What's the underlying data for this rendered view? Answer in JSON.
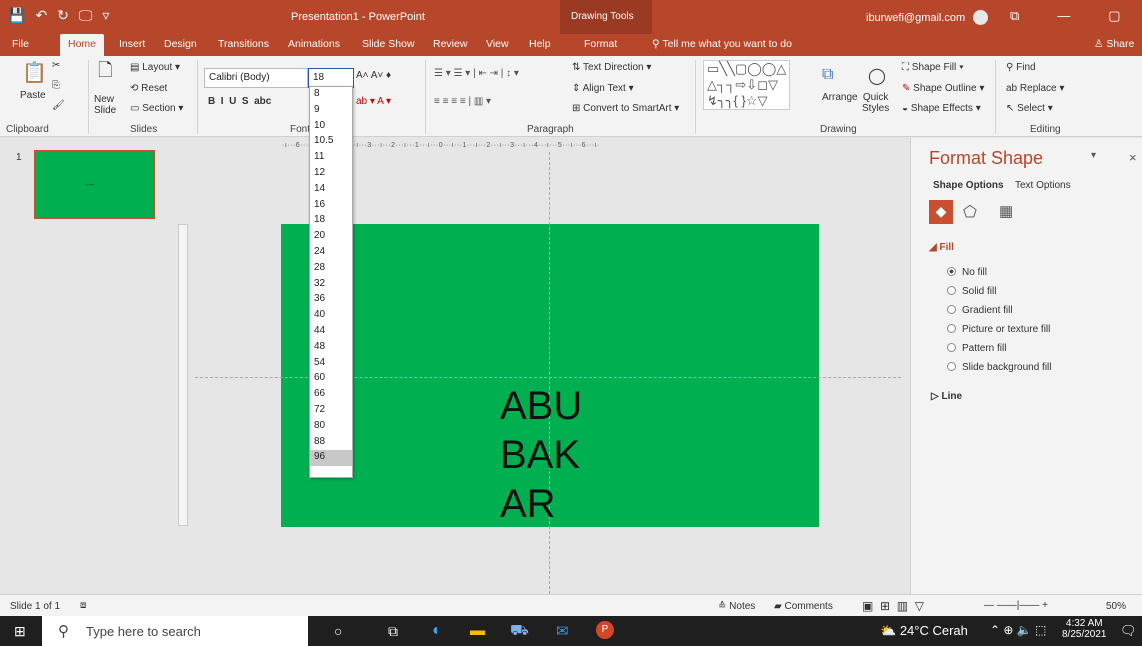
{
  "titlebar": {
    "title": "Presentation1 - PowerPoint",
    "context_tab": "Drawing Tools",
    "user": "iburwefi@gmail.com",
    "qat": [
      "💾",
      "↶",
      "↻",
      "🖵",
      "▿"
    ],
    "controls": [
      "⧉",
      "—",
      "▢"
    ]
  },
  "tabs": [
    "File",
    "Home",
    "Insert",
    "Design",
    "Transitions",
    "Animations",
    "Slide Show",
    "Review",
    "View",
    "Help",
    "Format"
  ],
  "tell_me": "Tell me what you want to do",
  "share": "Share",
  "ribbon": {
    "clipboard": {
      "paste": "Paste",
      "label": "Clipboard"
    },
    "slides": {
      "new_slide": "New\nSlide",
      "layout": "Layout",
      "reset": "Reset",
      "section": "Section",
      "label": "Slides"
    },
    "font": {
      "name": "Calibri (Body)",
      "size": "18",
      "label": "Font"
    },
    "paragraph": {
      "text_direction": "Text Direction",
      "align_text": "Align Text",
      "convert": "Convert to SmartArt",
      "label": "Paragraph"
    },
    "drawing": {
      "arrange": "Arrange",
      "quick_styles": "Quick\nStyles",
      "shape_fill": "Shape Fill",
      "shape_outline": "Shape Outline",
      "shape_effects": "Shape Effects",
      "label": "Drawing"
    },
    "editing": {
      "find": "Find",
      "replace": "Replace",
      "select": "Select",
      "label": "Editing"
    }
  },
  "font_sizes": [
    "8",
    "9",
    "10",
    "10.5",
    "11",
    "12",
    "14",
    "16",
    "18",
    "20",
    "24",
    "28",
    "32",
    "36",
    "40",
    "44",
    "48",
    "54",
    "60",
    "66",
    "72",
    "80",
    "88",
    "96"
  ],
  "selected_size": "96",
  "slide_thumb": {
    "number": "1",
    "text": "---"
  },
  "slide_text": [
    "ABU",
    "BAK",
    "AR"
  ],
  "format_pane": {
    "title": "Format Shape",
    "tab_shape": "Shape Options",
    "tab_text": "Text Options",
    "fill_heading": "Fill",
    "fill_options": [
      "No fill",
      "Solid fill",
      "Gradient fill",
      "Picture or texture fill",
      "Pattern fill",
      "Slide background fill"
    ],
    "selected_fill": "No fill",
    "line_heading": "Line"
  },
  "status": {
    "slide": "Slide 1 of 1",
    "notes": "Notes",
    "comments": "Comments",
    "zoom": "50%"
  },
  "taskbar": {
    "search": "Type here to search",
    "weather": "24°C Cerah",
    "time": "4:32 AM",
    "date": "8/25/2021"
  },
  "colors": {
    "accent": "#b7472a",
    "slide_fill": "#00b050"
  }
}
